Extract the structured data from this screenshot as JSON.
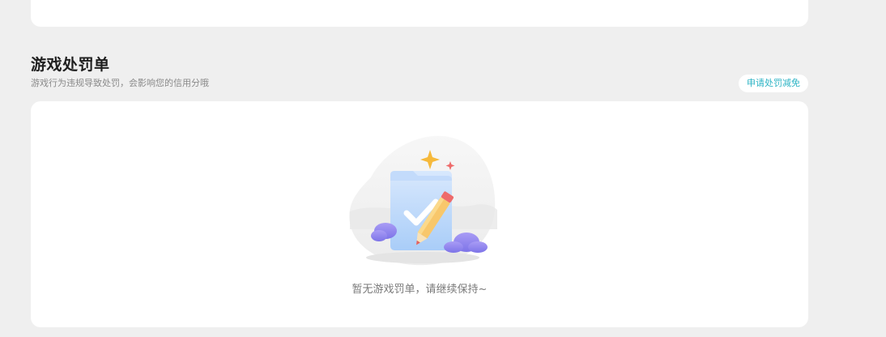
{
  "penalty_section": {
    "title": "游戏处罚单",
    "subtitle": "游戏行为违规导致处罚，会影响您的信用分哦",
    "appeal_button_label": "申请处罚减免",
    "empty_state_text": "暂无游戏罚单，请继续保持~",
    "illustration_icon": "empty-document-checklist-illustration"
  },
  "colors": {
    "page_background": "#efefef",
    "card_background": "#ffffff",
    "accent": "#2bb3c4",
    "title_text": "#1f1f1f",
    "muted_text": "#8a8a8a"
  }
}
